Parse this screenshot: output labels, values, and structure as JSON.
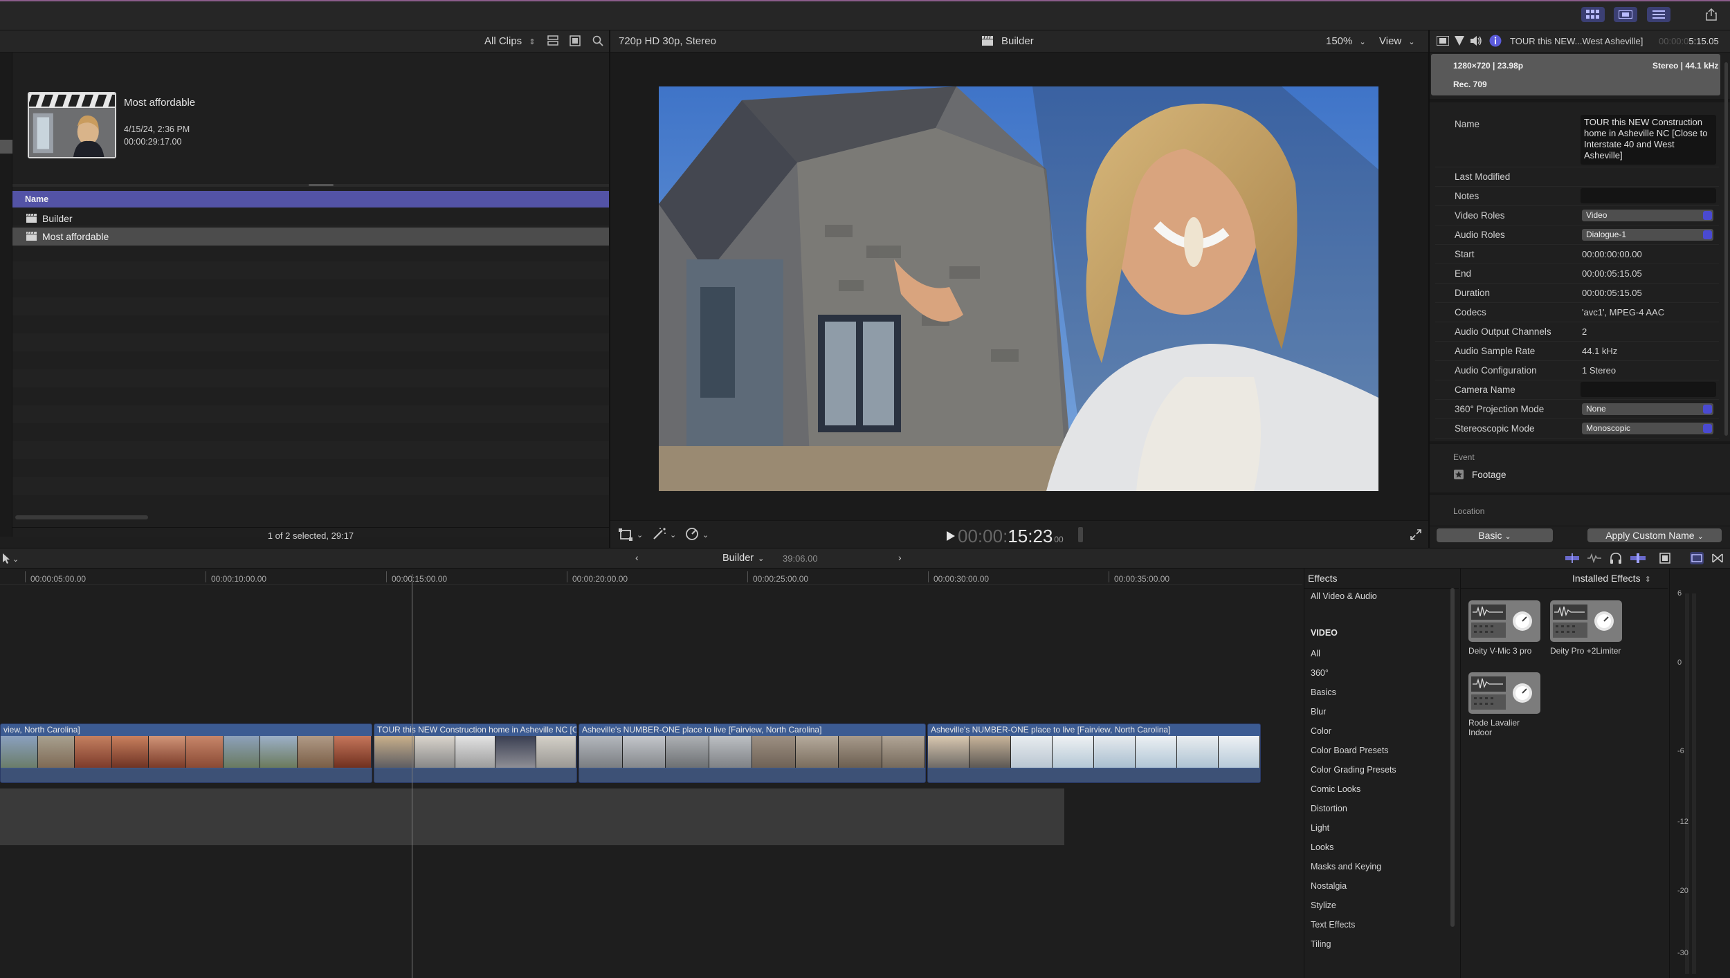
{
  "topbar": {
    "buttons": [
      "grid-icon",
      "filmstrip-icon",
      "sliders-icon",
      "share-icon"
    ]
  },
  "browser": {
    "filter": "All Clips",
    "featured": {
      "name": "Most affordable",
      "date": "4/15/24, 2:36 PM",
      "duration": "00:00:29:17.00"
    },
    "column_name": "Name",
    "rows": [
      {
        "label": "Builder"
      },
      {
        "label": "Most affordable"
      }
    ],
    "footer": "1 of 2 selected, 29:17"
  },
  "viewer": {
    "format": "720p HD 30p, Stereo",
    "title": "Builder",
    "zoom": "150%",
    "view_menu": "View",
    "timecode_dim": "00:00:",
    "timecode_bright": "15:23",
    "timecode_frames": "00"
  },
  "inspector": {
    "clip_title": "TOUR this NEW...West Asheville]",
    "duration_dim": "00:00:0",
    "duration": "5:15.05",
    "resolution": "1280×720 | 23.98p",
    "audio_format": "Stereo | 44.1 kHz",
    "colorspace": "Rec. 709",
    "name_label": "Name",
    "name_value": "TOUR this NEW Construction home in Asheville NC [Close to Interstate 40 and West Asheville]",
    "props": [
      {
        "label": "Last Modified",
        "value": ""
      },
      {
        "label": "Notes",
        "value": ""
      },
      {
        "label": "Video Roles",
        "value": "Video"
      },
      {
        "label": "Audio Roles",
        "value": "Dialogue-1"
      },
      {
        "label": "Start",
        "value": "00:00:00:00.00"
      },
      {
        "label": "End",
        "value": "00:00:05:15.05"
      },
      {
        "label": "Duration",
        "value": "00:00:05:15.05"
      },
      {
        "label": "Codecs",
        "value": "'avc1', MPEG-4 AAC"
      },
      {
        "label": "Audio Output Channels",
        "value": "2"
      },
      {
        "label": "Audio Sample Rate",
        "value": "44.1 kHz"
      },
      {
        "label": "Audio Configuration",
        "value": "1 Stereo"
      },
      {
        "label": "Camera Name",
        "value": ""
      },
      {
        "label": "360° Projection Mode",
        "value": "None"
      },
      {
        "label": "Stereoscopic Mode",
        "value": "Monoscopic"
      }
    ],
    "event_label": "Event",
    "event_value": "Footage",
    "location_label": "Location",
    "basic_button": "Basic",
    "apply_button": "Apply Custom Name"
  },
  "timeline": {
    "project": "Builder",
    "duration": "39:06.00",
    "ruler": [
      "00:00:05:00.00",
      "00:00:10:00.00",
      "00:00:15:00.00",
      "00:00:20:00.00",
      "00:00:25:00.00",
      "00:00:30:00.00",
      "00:00:35:00.00"
    ],
    "clips": [
      {
        "title": "view, North Carolina]"
      },
      {
        "title": "TOUR this NEW Construction home in Asheville NC [Cl..."
      },
      {
        "title": "Asheville's NUMBER-ONE place to live [Fairview, North Carolina]"
      },
      {
        "title": "Asheville's NUMBER-ONE place to live [Fairview, North Carolina]"
      }
    ]
  },
  "effects": {
    "header": "Effects",
    "all": "All Video & Audio",
    "section": "VIDEO",
    "categories": [
      "All",
      "360°",
      "Basics",
      "Blur",
      "Color",
      "Color Board Presets",
      "Color Grading Presets",
      "Comic Looks",
      "Distortion",
      "Light",
      "Looks",
      "Masks and Keying",
      "Nostalgia",
      "Stylize",
      "Text Effects",
      "Tiling"
    ],
    "installed": "Installed Effects",
    "items": [
      {
        "name": "Deity V-Mic 3 pro"
      },
      {
        "name": "Deity Pro +2Limiter"
      },
      {
        "name": "Rode Lavalier Indoor"
      }
    ]
  },
  "meter": {
    "labels": [
      "6",
      "0",
      "-6",
      "-12",
      "-20",
      "-30"
    ]
  },
  "colors": {
    "accent": "#5353a6",
    "clip": "#3c5b92",
    "button_blue": "#3b3f73"
  }
}
